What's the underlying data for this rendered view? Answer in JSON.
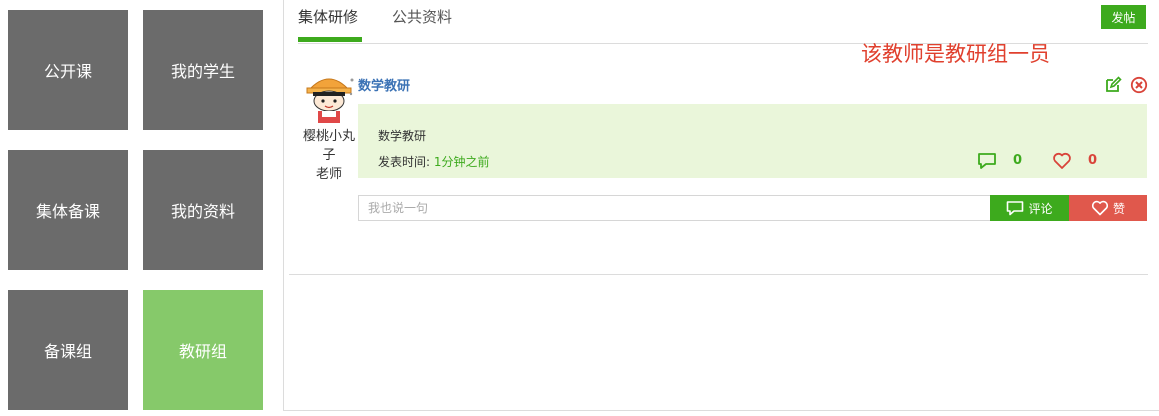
{
  "nav": {
    "tiles": [
      {
        "label": "公开课"
      },
      {
        "label": "我的学生"
      },
      {
        "label": "集体备课"
      },
      {
        "label": "我的资料"
      },
      {
        "label": "备课组"
      },
      {
        "label": "教研组",
        "active": true
      }
    ]
  },
  "tabs": [
    {
      "label": "集体研修",
      "active": true
    },
    {
      "label": "公共资料"
    }
  ],
  "post_button_label": "发帖",
  "annotation": "该教师是教研组一员",
  "post": {
    "title": "数学教研",
    "author_name": "樱桃小丸子",
    "author_role": "老师",
    "content": "数学教研",
    "time_label": "发表时间: ",
    "time_value": "1分钟之前",
    "comment_count": "0",
    "like_count": "0"
  },
  "comment": {
    "placeholder": "我也说一句",
    "comment_button": "评论",
    "like_button": "赞"
  },
  "colors": {
    "accent_green": "#3daa1d",
    "tile_gray": "#6b6b6b",
    "tile_active": "#86c96a",
    "like_red": "#e0584c",
    "annotation_red": "#e0402e"
  }
}
